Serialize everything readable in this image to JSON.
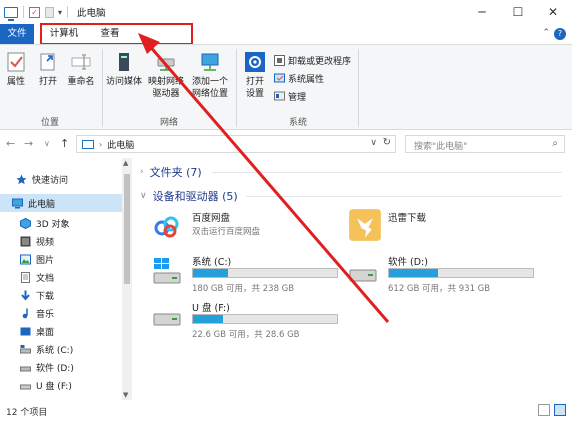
{
  "window": {
    "title": "此电脑",
    "minimize": "─",
    "maximize": "☐",
    "close": "✕"
  },
  "tabs": {
    "file": "文件",
    "computer": "计算机",
    "view": "查看",
    "ribbon_toggle": "⌃",
    "help": "?"
  },
  "ribbon": {
    "location": {
      "label": "位置",
      "properties": "属性",
      "open": "打开",
      "rename": "重命名"
    },
    "network": {
      "label": "网络",
      "access_media": "访问媒体",
      "map_drive": "映射网络",
      "map_drive_2": "驱动器",
      "add_location": "添加一个",
      "add_location_2": "网络位置"
    },
    "system": {
      "label": "系统",
      "open_settings": "打开",
      "open_settings_2": "设置",
      "uninstall": "卸载或更改程序",
      "system_properties": "系统属性",
      "manage": "管理"
    }
  },
  "address": {
    "path": "此电脑",
    "search_placeholder": "搜索\"此电脑\""
  },
  "sidebar": {
    "items": [
      {
        "label": "快速访问",
        "icon": "star-icon"
      },
      {
        "label": "此电脑",
        "icon": "pc-icon"
      },
      {
        "label": "3D 对象",
        "icon": "cube-icon"
      },
      {
        "label": "视频",
        "icon": "video-icon"
      },
      {
        "label": "图片",
        "icon": "picture-icon"
      },
      {
        "label": "文档",
        "icon": "document-icon"
      },
      {
        "label": "下载",
        "icon": "download-icon"
      },
      {
        "label": "音乐",
        "icon": "music-icon"
      },
      {
        "label": "桌面",
        "icon": "desktop-icon"
      },
      {
        "label": "系统 (C:)",
        "icon": "drive-icon"
      },
      {
        "label": "软件 (D:)",
        "icon": "drive-icon"
      },
      {
        "label": "U 盘 (F:)",
        "icon": "usb-drive-icon"
      }
    ]
  },
  "main": {
    "folders_header": "文件夹 (7)",
    "devices_header": "设备和驱动器 (5)",
    "baidu": {
      "name": "百度网盘",
      "sub": "双击运行百度网盘"
    },
    "xunlei": {
      "name": "迅雷下载"
    },
    "drives": [
      {
        "name": "系统 (C:)",
        "info": "180 GB 可用，共 238 GB",
        "used_fraction": 0.24
      },
      {
        "name": "软件 (D:)",
        "info": "612 GB 可用，共 931 GB",
        "used_fraction": 0.34
      },
      {
        "name": "U 盘 (F:)",
        "info": "22.6 GB 可用，共 28.6 GB",
        "used_fraction": 0.21
      }
    ]
  },
  "status": {
    "item_count": "12 个项目"
  },
  "colors": {
    "accent": "#1a66c2",
    "highlight": "#e02020",
    "drive_fill": "#26a0da"
  }
}
